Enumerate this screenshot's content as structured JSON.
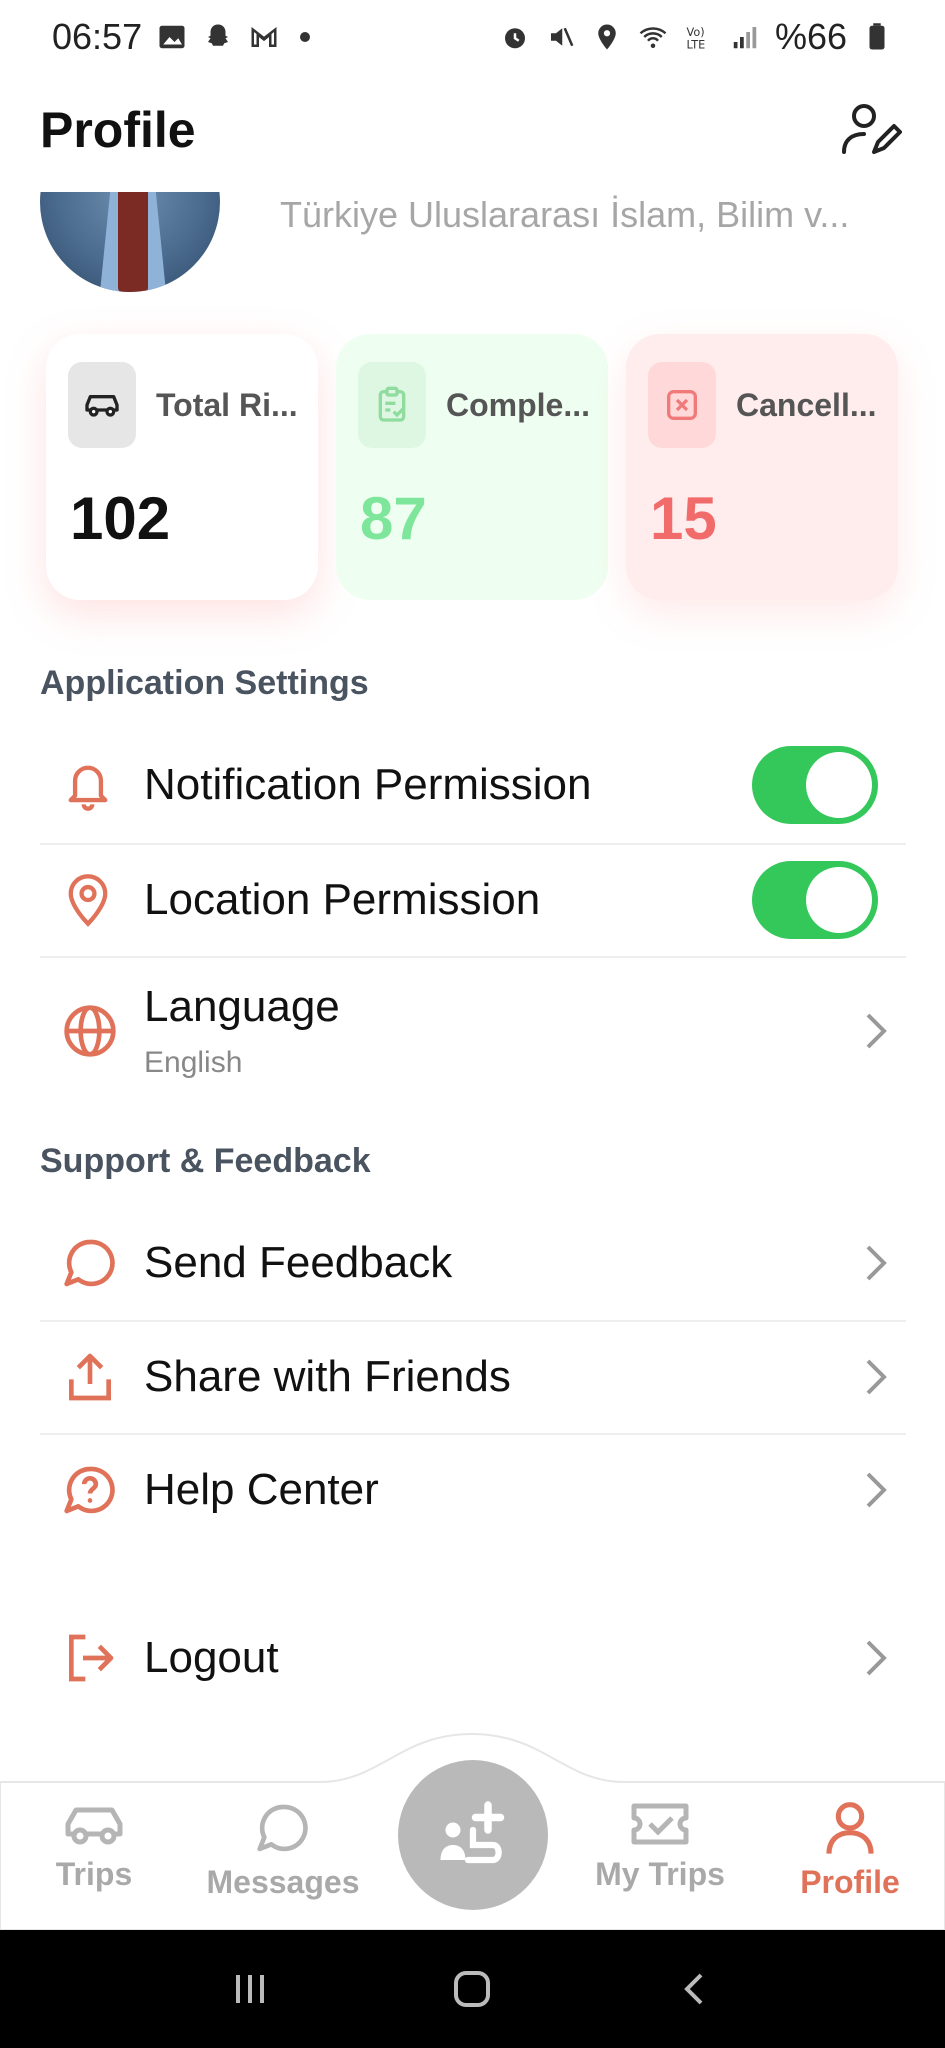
{
  "status_bar": {
    "time": "06:57",
    "battery": "%66"
  },
  "header": {
    "title": "Profile"
  },
  "profile": {
    "university": "Türkiye Uluslararası İslam, Bilim v..."
  },
  "stats": [
    {
      "label": "Total Ri...",
      "value": "102"
    },
    {
      "label": "Comple...",
      "value": "87"
    },
    {
      "label": "Cancell...",
      "value": "15"
    }
  ],
  "app_settings": {
    "title": "Application Settings",
    "notification": {
      "label": "Notification Permission",
      "enabled": true
    },
    "location": {
      "label": "Location Permission",
      "enabled": true
    },
    "language": {
      "label": "Language",
      "value": "English"
    }
  },
  "support": {
    "title": "Support & Feedback",
    "feedback": "Send Feedback",
    "share": "Share with Friends",
    "help": "Help Center"
  },
  "logout": "Logout",
  "nav": {
    "trips": "Trips",
    "messages": "Messages",
    "my_trips": "My Trips",
    "profile": "Profile"
  },
  "colors": {
    "accent": "#e0725a",
    "toggle_on": "#34c759",
    "completed": "#7ee69a",
    "cancelled": "#f26b6b"
  }
}
